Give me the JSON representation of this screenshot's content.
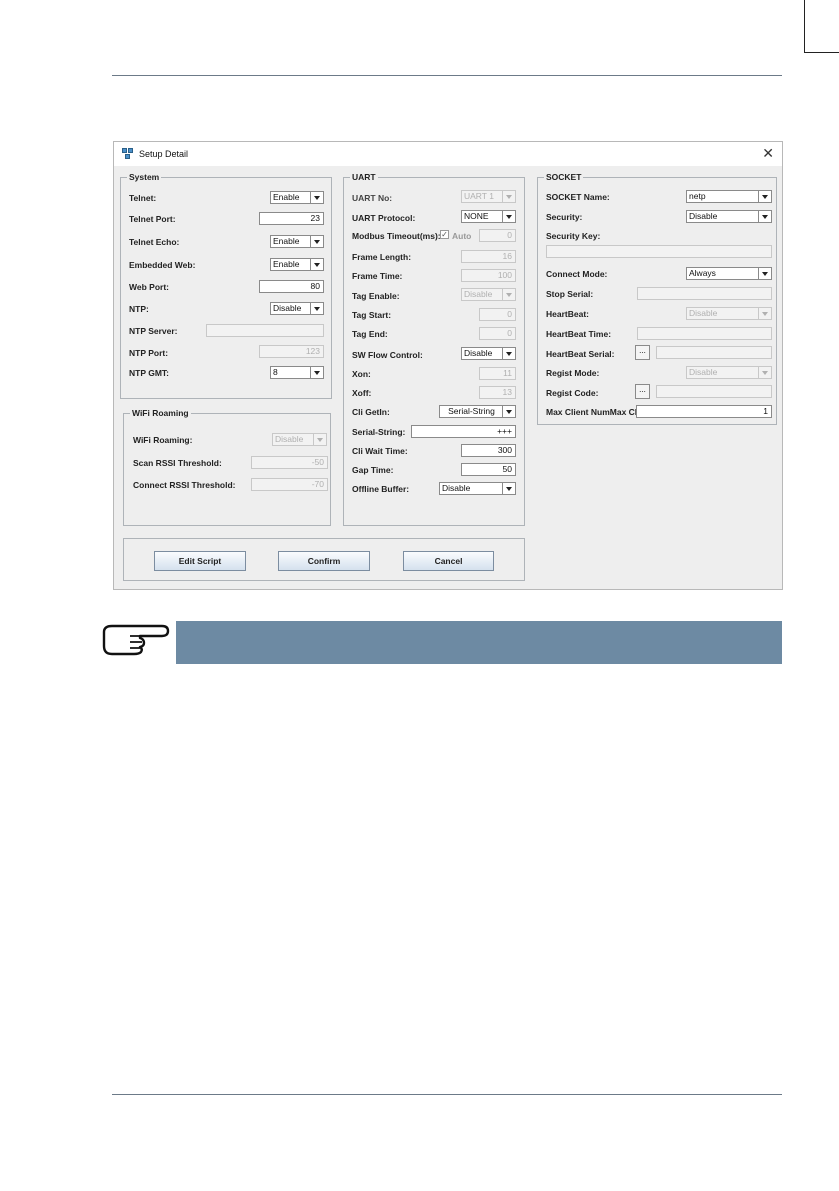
{
  "window": {
    "title": "Setup Detail",
    "close_symbol": "✕"
  },
  "system": {
    "title": "System",
    "telnet": {
      "label": "Telnet:",
      "value": "Enable"
    },
    "telnet_port": {
      "label": "Telnet Port:",
      "value": "23"
    },
    "telnet_echo": {
      "label": "Telnet Echo:",
      "value": "Enable"
    },
    "embedded_web": {
      "label": "Embedded Web:",
      "value": "Enable"
    },
    "web_port": {
      "label": "Web Port:",
      "value": "80"
    },
    "ntp": {
      "label": "NTP:",
      "value": "Disable"
    },
    "ntp_server": {
      "label": "NTP Server:",
      "value": ""
    },
    "ntp_port": {
      "label": "NTP Port:",
      "value": "123"
    },
    "ntp_gmt": {
      "label": "NTP GMT:",
      "value": "8"
    }
  },
  "wifi": {
    "title": "WiFi Roaming",
    "roaming": {
      "label": "WiFi Roaming:",
      "value": "Disable"
    },
    "scan_rssi": {
      "label": "Scan RSSI Threshold:",
      "value": "-50"
    },
    "connect_rssi": {
      "label": "Connect RSSI Threshold:",
      "value": "-70"
    }
  },
  "uart": {
    "title": "UART",
    "uart_no": {
      "label": "UART No:",
      "value": "UART 1"
    },
    "protocol": {
      "label": "UART Protocol:",
      "value": "NONE"
    },
    "modbus_timeout": {
      "label": "Modbus Timeout(ms):",
      "check_mark": "✓",
      "auto_label": "Auto",
      "value": "0"
    },
    "frame_length": {
      "label": "Frame Length:",
      "value": "16"
    },
    "frame_time": {
      "label": "Frame Time:",
      "value": "100"
    },
    "tag_enable": {
      "label": "Tag Enable:",
      "value": "Disable"
    },
    "tag_start": {
      "label": "Tag Start:",
      "value": "0"
    },
    "tag_end": {
      "label": "Tag End:",
      "value": "0"
    },
    "sw_flow": {
      "label": "SW Flow Control:",
      "value": "Disable"
    },
    "xon": {
      "label": "Xon:",
      "value": "11"
    },
    "xoff": {
      "label": "Xoff:",
      "value": "13"
    },
    "cli_getin": {
      "label": "Cli GetIn:",
      "value": "Serial-String"
    },
    "serial_string": {
      "label": "Serial-String:",
      "value": "+++"
    },
    "cli_wait": {
      "label": "Cli Wait Time:",
      "value": "300"
    },
    "gap_time": {
      "label": "Gap Time:",
      "value": "50"
    },
    "offline_buffer": {
      "label": "Offline Buffer:",
      "value": "Disable"
    }
  },
  "socket": {
    "title": "SOCKET",
    "name": {
      "label": "SOCKET Name:",
      "value": "netp"
    },
    "security": {
      "label": "Security:",
      "value": "Disable"
    },
    "security_key": {
      "label": "Security Key:",
      "value": ""
    },
    "connect_mode": {
      "label": "Connect Mode:",
      "value": "Always"
    },
    "stop_serial": {
      "label": "Stop Serial:",
      "value": ""
    },
    "heartbeat": {
      "label": "HeartBeat:",
      "value": "Disable"
    },
    "heartbeat_time": {
      "label": "HeartBeat Time:",
      "value": ""
    },
    "heartbeat_serial": {
      "label": "HeartBeat Serial:",
      "button": "...",
      "value": ""
    },
    "regist_mode": {
      "label": "Regist Mode:",
      "value": "Disable"
    },
    "regist_code": {
      "label": "Regist Code:",
      "button": "...",
      "value": ""
    },
    "max_client": {
      "label": "Max Client NumMax Cl...",
      "value": "1"
    }
  },
  "buttons": {
    "edit_script": "Edit Script",
    "confirm": "Confirm",
    "cancel": "Cancel"
  }
}
